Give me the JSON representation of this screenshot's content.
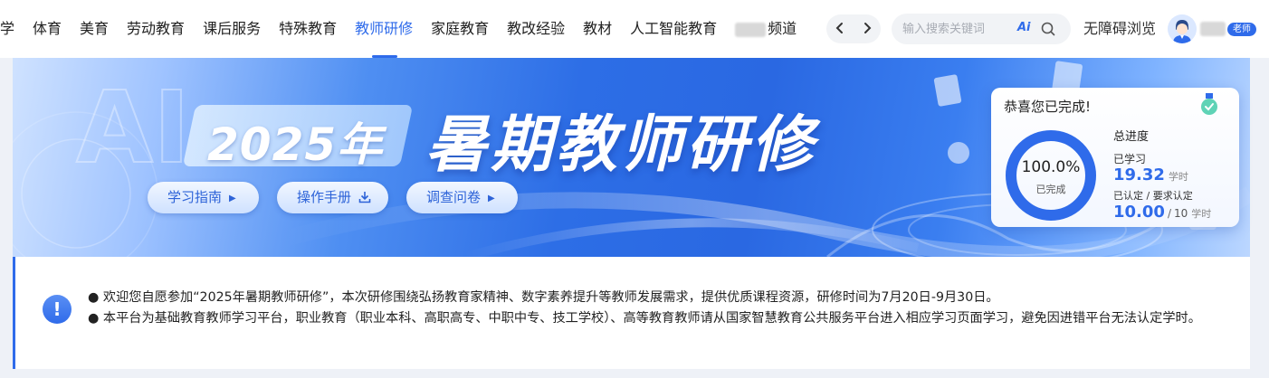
{
  "nav": {
    "items": [
      {
        "label": "教学"
      },
      {
        "label": "体育"
      },
      {
        "label": "美育"
      },
      {
        "label": "劳动教育"
      },
      {
        "label": "课后服务"
      },
      {
        "label": "特殊教育"
      },
      {
        "label": "教师研修",
        "active": true
      },
      {
        "label": "家庭教育"
      },
      {
        "label": "教改经验"
      },
      {
        "label": "教材"
      },
      {
        "label": "人工智能教育"
      }
    ],
    "channel_suffix": "频道",
    "prev_icon": "chevron-left-icon",
    "next_icon": "chevron-right-icon"
  },
  "search": {
    "placeholder": "输入搜索关键词",
    "ai_label": "Ai",
    "icon": "search-icon"
  },
  "accessibility_label": "无障碍浏览",
  "user": {
    "role_badge": "老师",
    "avatar_icon": "avatar-icon"
  },
  "banner": {
    "year": "2025年",
    "title": "暑期教师研修",
    "buttons": {
      "guide": "学习指南",
      "manual": "操作手册",
      "survey": "调查问卷"
    },
    "accent": "#2f6bea"
  },
  "progress": {
    "congrats": "恭喜您已完成!",
    "percent_text": "100.0%",
    "percent_value": 1.0,
    "status": "已完成",
    "total_label": "总进度",
    "learned_label": "已学习",
    "learned_value": "19.32",
    "unit": "学时",
    "certified_label": "已认定 / 要求认定",
    "certified_value": "10.00",
    "required_value": "10",
    "sep": "/"
  },
  "notice": {
    "icon": "exclamation-icon",
    "line1": "● 欢迎您自愿参加“2025年暑期教师研修”，本次研修围绕弘扬教育家精神、数字素养提升等教师发展需求，提供优质课程资源，研修时间为7月20日-9月30日。",
    "line2": "● 本平台为基础教育教师学习平台，职业教育（职业本科、高职高专、中职中专、技工学校）、高等教育教师请从国家智慧教育公共服务平台进入相应学习页面学习，避免因进错平台无法认定学时。"
  }
}
